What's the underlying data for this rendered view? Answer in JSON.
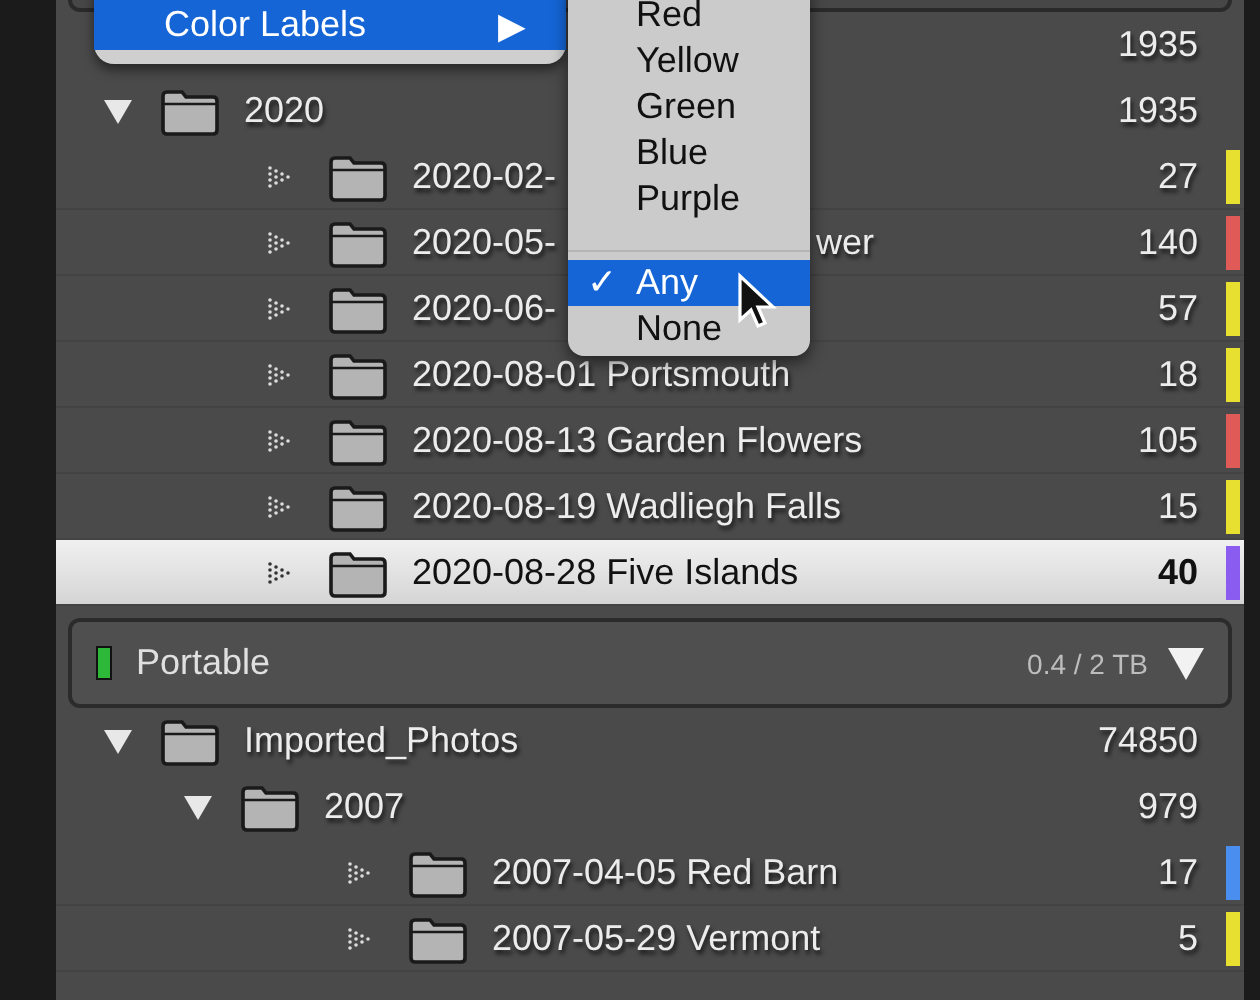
{
  "folders": [
    {
      "kind": "hidden",
      "count": "1935",
      "children": [
        {
          "kind": "folder",
          "name": "2020",
          "count": "1935",
          "expanded": true,
          "selected": false,
          "children": [
            {
              "kind": "leaf",
              "name": "2020-02-",
              "count": "27",
              "color": "#e8e030",
              "selected": false
            },
            {
              "kind": "leaf",
              "name": "2020-05-",
              "tail": "wer",
              "count": "140",
              "color": "#e05a58",
              "selected": false
            },
            {
              "kind": "leaf",
              "name": "2020-06-",
              "count": "57",
              "color": "#e8e030",
              "selected": false
            },
            {
              "kind": "leaf",
              "name": "2020-08-01 Portsmouth",
              "count": "18",
              "color": "#e8e030",
              "selected": false
            },
            {
              "kind": "leaf",
              "name": "2020-08-13 Garden Flowers",
              "count": "105",
              "color": "#e05a58",
              "selected": false
            },
            {
              "kind": "leaf",
              "name": "2020-08-19 Wadliegh Falls",
              "count": "15",
              "color": "#e8e030",
              "selected": false
            },
            {
              "kind": "leaf",
              "name": "2020-08-28 Five Islands",
              "count": "40",
              "color": "#8a5cf0",
              "selected": true
            }
          ]
        }
      ]
    }
  ],
  "volume": {
    "name": "Portable",
    "capacity": "0.4 / 2 TB",
    "expanded": true
  },
  "volume_folders": [
    {
      "kind": "folder",
      "name": "Imported_Photos",
      "count": "74850",
      "expanded": true,
      "selected": false,
      "children": [
        {
          "kind": "folder",
          "name": "2007",
          "count": "979",
          "expanded": true,
          "selected": false,
          "children": [
            {
              "kind": "leaf",
              "name": "2007-04-05 Red Barn",
              "count": "17",
              "color": "#4a8ef0",
              "selected": false
            },
            {
              "kind": "leaf",
              "name": "2007-05-29 Vermont",
              "count": "5",
              "color": "#e8e030",
              "selected": false
            }
          ]
        }
      ]
    }
  ],
  "menu": {
    "item": {
      "label": "Color Labels",
      "arrow": "▶"
    },
    "check": "✓",
    "groups": [
      [
        {
          "label": "Red",
          "selected": false
        },
        {
          "label": "Yellow",
          "selected": false
        },
        {
          "label": "Green",
          "selected": false
        },
        {
          "label": "Blue",
          "selected": false
        },
        {
          "label": "Purple",
          "selected": false
        }
      ],
      [
        {
          "label": "Any",
          "selected": true
        },
        {
          "label": "None",
          "selected": false
        }
      ]
    ]
  }
}
